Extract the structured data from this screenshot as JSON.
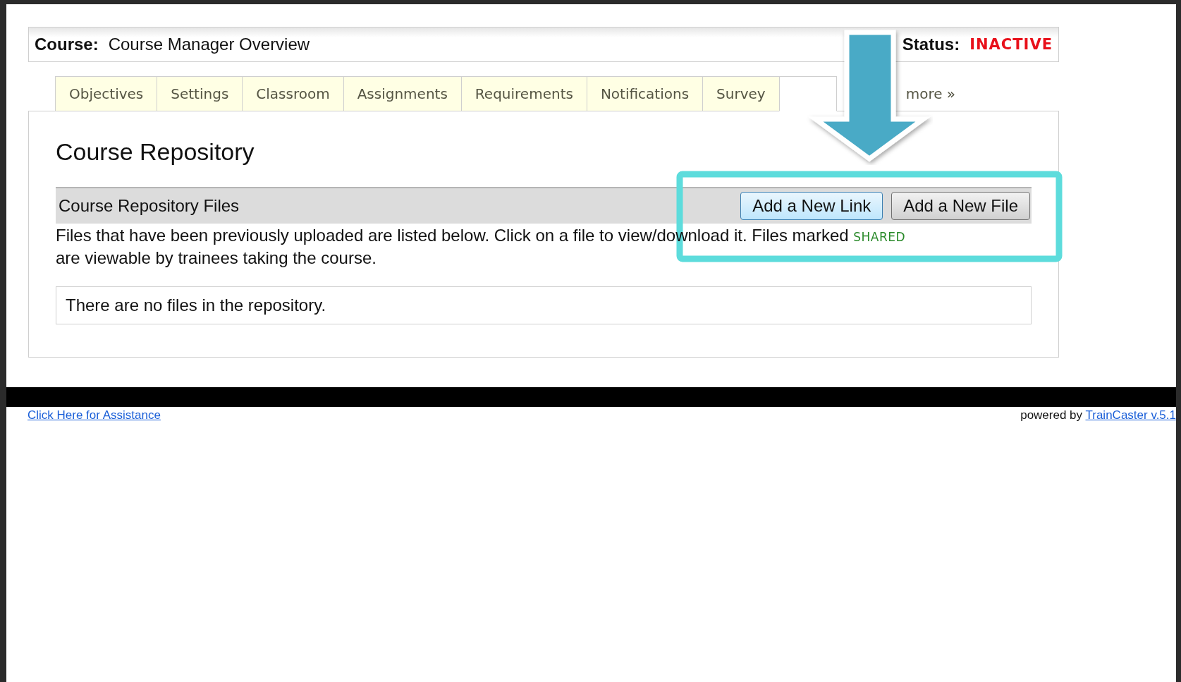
{
  "course_bar": {
    "label": "Course:",
    "name": "Course Manager Overview",
    "status_label": "Status:",
    "status": "INACTIVE"
  },
  "tabs": [
    {
      "label": "Objectives",
      "selected": false
    },
    {
      "label": "Settings",
      "selected": false
    },
    {
      "label": "Classroom",
      "selected": false
    },
    {
      "label": "Assignments",
      "selected": false
    },
    {
      "label": "Requirements",
      "selected": false
    },
    {
      "label": "Notifications",
      "selected": false
    },
    {
      "label": "Survey",
      "selected": false
    },
    {
      "selected": true
    }
  ],
  "more_link": "more »",
  "heading": "Course Repository",
  "files_bar": {
    "title": "Course Repository Files",
    "buttons": [
      {
        "label": "Add a New Link",
        "selected": true
      },
      {
        "label": "Add a New File",
        "selected": false
      }
    ]
  },
  "description": {
    "text": "Files that have been previously uploaded are listed below. Click on a file to view/download it. Files marked",
    "tag": "SHARED",
    "text_after": "are viewable by trainees taking the course."
  },
  "empty_message": "There are no files in the repository.",
  "footer": {
    "help_link": "Click Here for Assistance",
    "powered_by": "powered by",
    "product_link": "TrainCaster v.5.1"
  }
}
